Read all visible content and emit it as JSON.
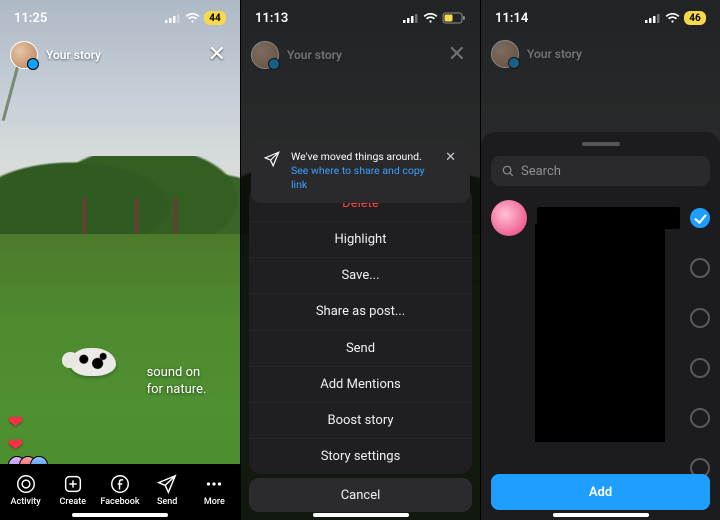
{
  "phone1": {
    "status": {
      "time": "11:25",
      "battery": "44"
    },
    "header": {
      "title": "Your story"
    },
    "caption_line1": "sound on",
    "caption_line2": "for nature.",
    "toolbar": {
      "activity": "Activity",
      "create": "Create",
      "facebook": "Facebook",
      "send": "Send",
      "more": "More"
    }
  },
  "phone2": {
    "status": {
      "time": "11:13"
    },
    "header": {
      "title": "Your story"
    },
    "hint": {
      "line1": "We've moved things around.",
      "link": "See where to share and copy link"
    },
    "menu": {
      "delete": "Delete",
      "highlight": "Highlight",
      "save": "Save...",
      "share_post": "Share as post...",
      "send": "Send",
      "add_mentions": "Add Mentions",
      "boost": "Boost story",
      "settings": "Story settings"
    },
    "cancel": "Cancel"
  },
  "phone3": {
    "status": {
      "time": "11:14",
      "battery": "46"
    },
    "header": {
      "title": "Your story"
    },
    "search_placeholder": "Search",
    "add": "Add"
  }
}
